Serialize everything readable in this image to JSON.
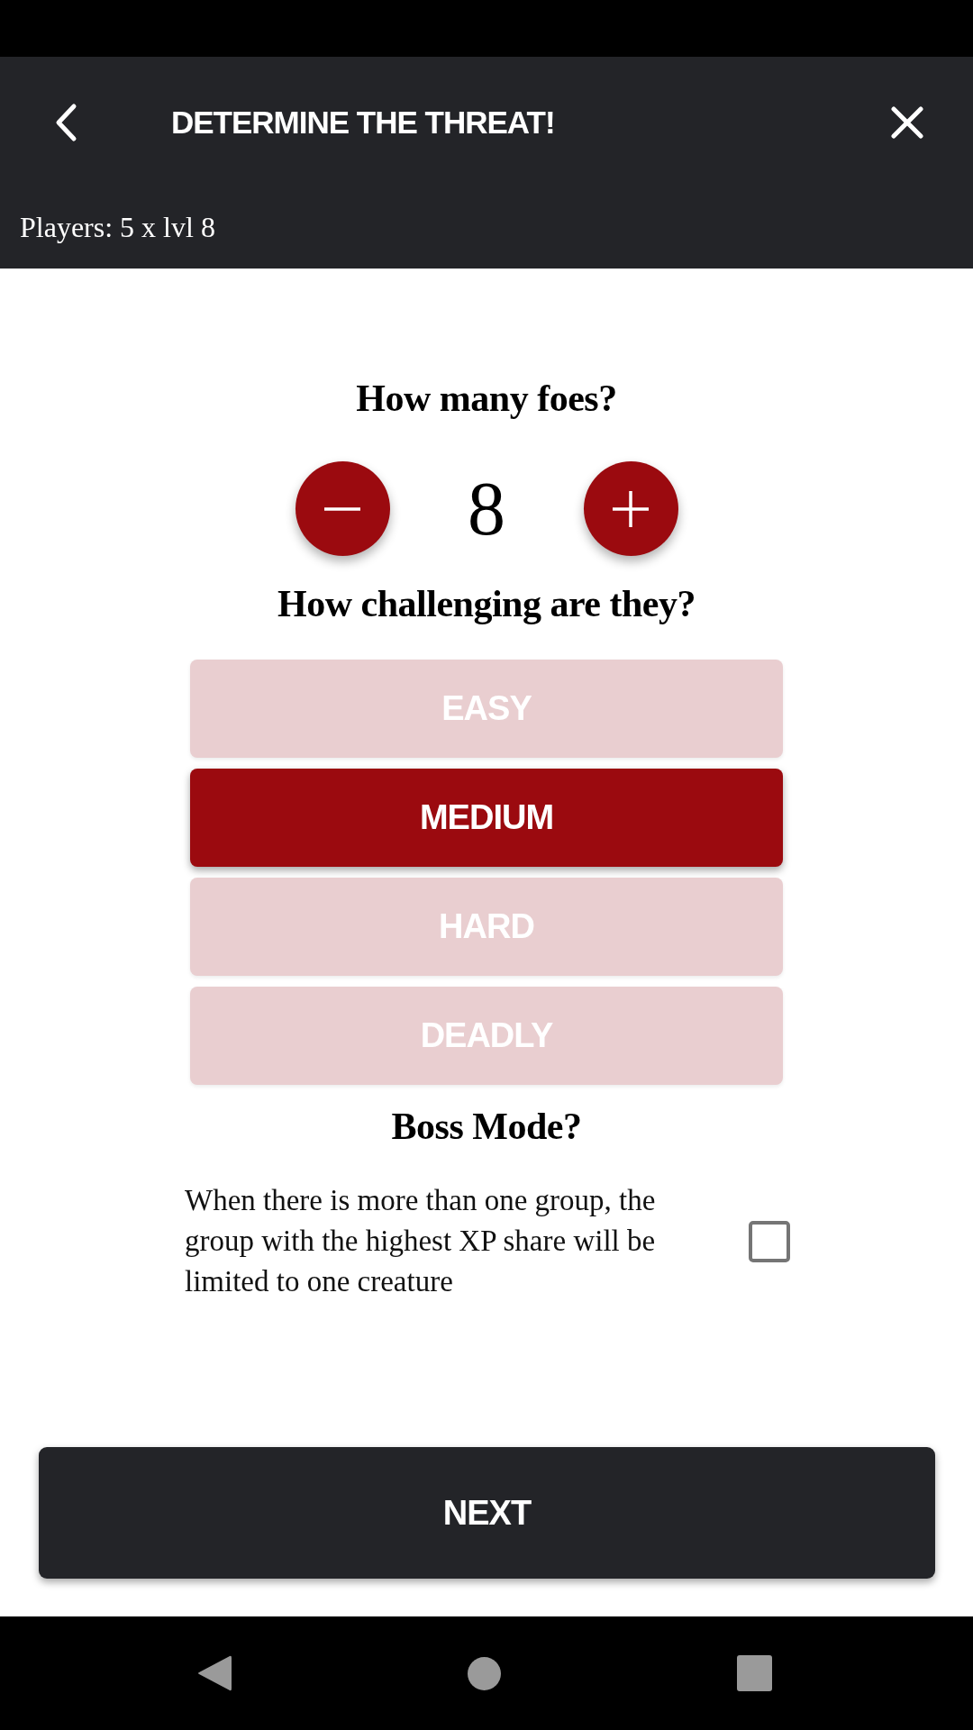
{
  "header": {
    "title": "DETERMINE THE THREAT!",
    "subtitle": "Players: 5 x lvl 8"
  },
  "foes": {
    "question": "How many foes?",
    "count": "8"
  },
  "challenge": {
    "question": "How challenging are they?",
    "options": [
      {
        "label": "EASY",
        "selected": false
      },
      {
        "label": "MEDIUM",
        "selected": true
      },
      {
        "label": "HARD",
        "selected": false
      },
      {
        "label": "DEADLY",
        "selected": false
      }
    ]
  },
  "boss_mode": {
    "question": "Boss Mode?",
    "description": "When there is more than one group, the group with the highest XP share will be limited to one creature",
    "checked": false
  },
  "next_button": {
    "label": "NEXT"
  }
}
